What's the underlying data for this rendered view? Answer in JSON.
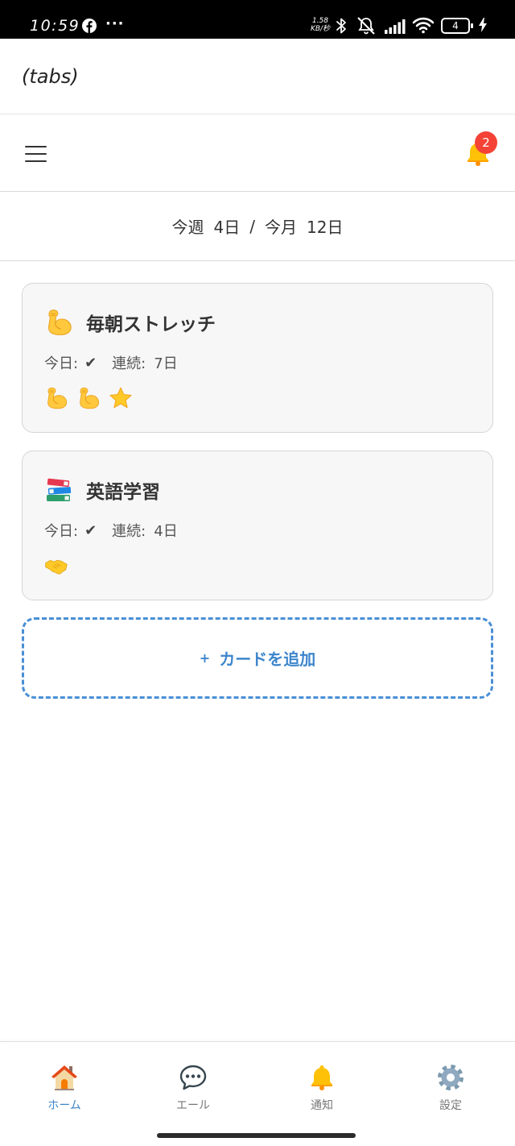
{
  "status_bar": {
    "time": "10:59",
    "more": "···",
    "net_speed_value": "1.58",
    "net_speed_unit": "KB/秒",
    "battery_level": "4",
    "icons": [
      "facebook",
      "bluetooth",
      "bell-muted",
      "signal",
      "wifi",
      "battery",
      "charging"
    ]
  },
  "header": {
    "title": "(tabs)"
  },
  "toolbar": {
    "menu_icon": "hamburger-menu",
    "notification_icon": "bell",
    "badge_count": "2"
  },
  "stats": {
    "week_label": "今週",
    "week_days": "4日",
    "separator": "/",
    "month_label": "今月",
    "month_days": "12日"
  },
  "cards": [
    {
      "icon": "flexed-biceps",
      "title": "毎朝ストレッチ",
      "today_label": "今日:",
      "today_mark": "✔",
      "streak_label": "連続:",
      "streak_value": "7日",
      "stamps": [
        "flexed-biceps",
        "flexed-biceps",
        "star"
      ]
    },
    {
      "icon": "books",
      "title": "英語学習",
      "today_label": "今日:",
      "today_mark": "✔",
      "streak_label": "連続:",
      "streak_value": "4日",
      "stamps": [
        "handshake"
      ]
    }
  ],
  "add_card": {
    "plus": "+",
    "label": "カードを追加"
  },
  "bottom_nav": [
    {
      "icon": "house",
      "label": "ホーム",
      "active": true
    },
    {
      "icon": "speech-balloon",
      "label": "エール",
      "active": false
    },
    {
      "icon": "bell",
      "label": "通知",
      "active": false
    },
    {
      "icon": "gear",
      "label": "設定",
      "active": false
    }
  ],
  "colors": {
    "accent": "#4A8FD6",
    "accent_text": "#3D86CC",
    "active_nav": "#3F86C6",
    "badge": "#F44336",
    "card_bg": "#F7F7F7",
    "card_border": "#D6D6D6"
  }
}
